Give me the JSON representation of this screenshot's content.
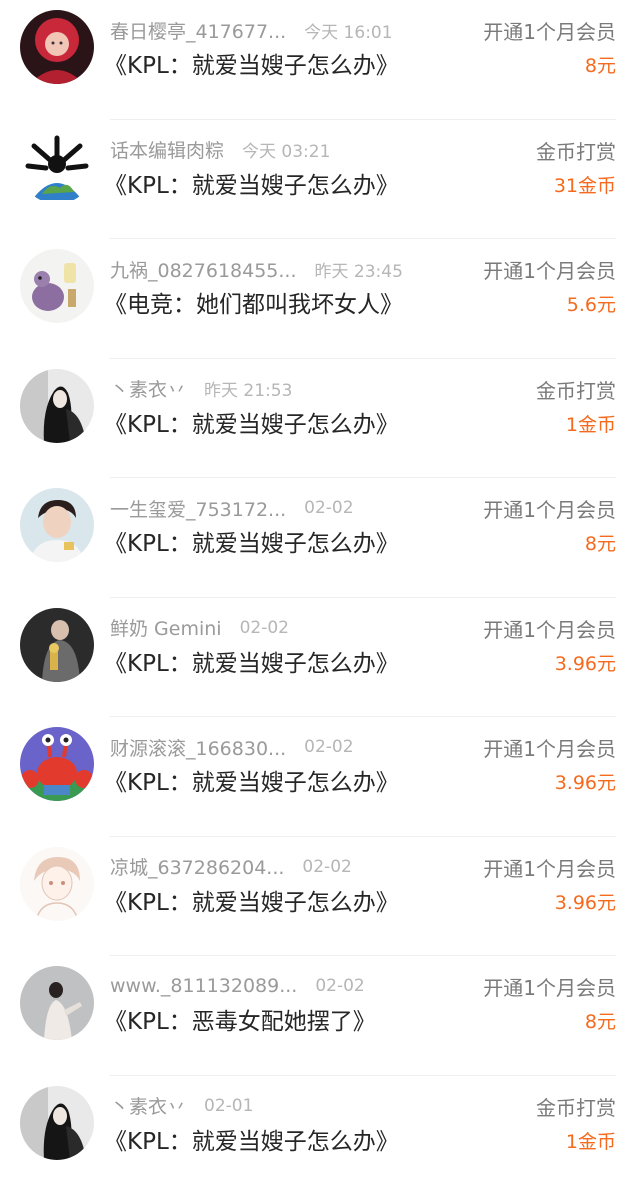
{
  "records": [
    {
      "username": "春日樱亭_417677...",
      "time": "今天 16:01",
      "work": "《KPL：就爱当嫂子怎么办》",
      "action": "开通1个月会员",
      "amount": "8元",
      "avatar_icon": "avatar-girl-red-hair"
    },
    {
      "username": "话本编辑肉粽",
      "time": "今天 03:21",
      "work": "《KPL：就爱当嫂子怎么办》",
      "action": "金币打赏",
      "amount": "31金币",
      "avatar_icon": "avatar-earth-bones"
    },
    {
      "username": "九祸_0827618455...",
      "time": "昨天 23:45",
      "work": "《电竞：她们都叫我坏女人》",
      "action": "开通1个月会员",
      "amount": "5.6元",
      "avatar_icon": "avatar-purple-cartoon"
    },
    {
      "username": "丶素衣丷",
      "time": "昨天 21:53",
      "work": "《KPL：就爱当嫂子怎么办》",
      "action": "金币打赏",
      "amount": "1金币",
      "avatar_icon": "avatar-black-white-photo"
    },
    {
      "username": "一生玺爱_753172...",
      "time": "02-02",
      "work": "《KPL：就爱当嫂子怎么办》",
      "action": "开通1个月会员",
      "amount": "8元",
      "avatar_icon": "avatar-boy-photo"
    },
    {
      "username": "鲜奶 Gemini",
      "time": "02-02",
      "work": "《KPL：就爱当嫂子怎么办》",
      "action": "开通1个月会员",
      "amount": "3.96元",
      "avatar_icon": "avatar-award-photo"
    },
    {
      "username": "财源滚滚_166830...",
      "time": "02-02",
      "work": "《KPL：就爱当嫂子怎么办》",
      "action": "开通1个月会员",
      "amount": "3.96元",
      "avatar_icon": "avatar-crab-cartoon"
    },
    {
      "username": "凉城_637286204...",
      "time": "02-02",
      "work": "《KPL：就爱当嫂子怎么办》",
      "action": "开通1个月会员",
      "amount": "3.96元",
      "avatar_icon": "avatar-anime-sketch"
    },
    {
      "username": "www._811132089...",
      "time": "02-02",
      "work": "《KPL：恶毒女配她摆了》",
      "action": "开通1个月会员",
      "amount": "8元",
      "avatar_icon": "avatar-grey-photo"
    },
    {
      "username": "丶素衣丷",
      "time": "02-01",
      "work": "《KPL：就爱当嫂子怎么办》",
      "action": "金币打赏",
      "amount": "1金币",
      "avatar_icon": "avatar-black-white-photo"
    }
  ],
  "colors": {
    "amount": "#f56a1e",
    "username": "#9a9a9a",
    "time": "#b6b6b6",
    "action": "#7a7a7a",
    "title": "#262626"
  }
}
